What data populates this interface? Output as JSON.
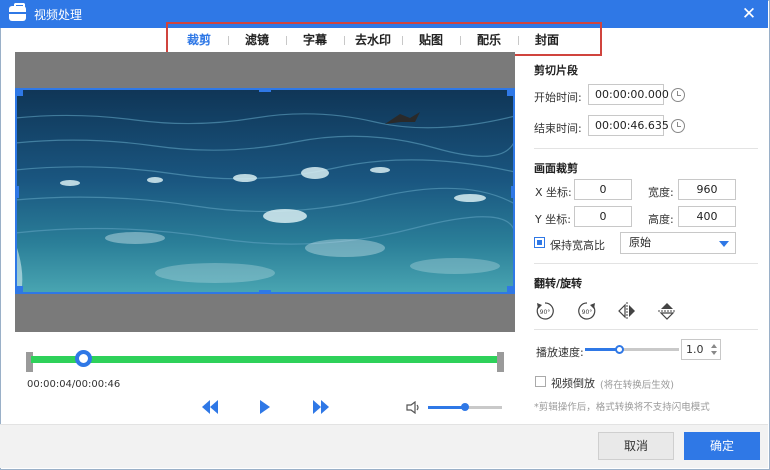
{
  "window": {
    "title": "视频处理",
    "close_icon": "close-icon"
  },
  "tabs": [
    {
      "label": "裁剪",
      "active": true
    },
    {
      "label": "滤镜"
    },
    {
      "label": "字幕"
    },
    {
      "label": "去水印"
    },
    {
      "label": "贴图"
    },
    {
      "label": "配乐"
    },
    {
      "label": "封面"
    }
  ],
  "player": {
    "time_display": "00:00:04/00:00:46",
    "progress_fraction": 0.11,
    "volume_fraction": 0.5
  },
  "trim": {
    "title": "剪切片段",
    "start_label": "开始时间:",
    "start_value": "00:00:00.000",
    "end_label": "结束时间:",
    "end_value": "00:00:46.635"
  },
  "crop": {
    "title": "画面裁剪",
    "x_label": "X 坐标:",
    "x_value": "0",
    "width_label": "宽度:",
    "width_value": "960",
    "y_label": "Y 坐标:",
    "y_value": "0",
    "height_label": "高度:",
    "height_value": "400",
    "keep_ratio_label": "保持宽高比",
    "keep_ratio_checked": true,
    "ratio_option": "原始"
  },
  "flip": {
    "title": "翻转/旋转",
    "rotate_label": "90°"
  },
  "playback": {
    "speed_label": "播放速度:",
    "speed_value": "1.0",
    "reverse_label": "视频倒放",
    "reverse_note": "(将在转换后生效)",
    "footnote": "*剪辑操作后，格式转换将不支持闪电模式"
  },
  "footer": {
    "cancel_label": "取消",
    "ok_label": "确定"
  },
  "colors": {
    "accent": "#2f78e6",
    "timeline": "#2ed15a",
    "highlight_box": "#d0443e"
  }
}
